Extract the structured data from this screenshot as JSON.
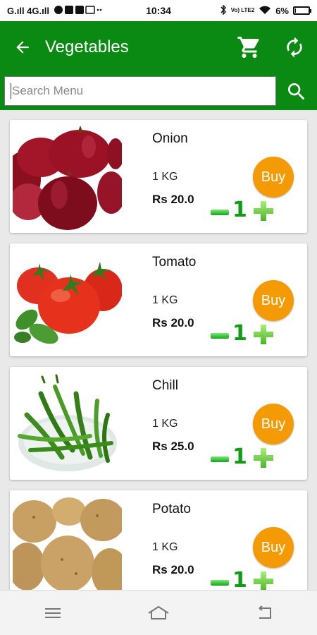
{
  "status_bar": {
    "left_text": "G.ıll 4G.ıll",
    "time": "10:34",
    "battery": "6%",
    "battery_level": 0.06,
    "network_badge": "Vo) LTE2"
  },
  "app_bar": {
    "title": "Vegetables",
    "back_icon": "arrow-left-icon",
    "cart_icon": "cart-icon",
    "refresh_icon": "refresh-icon",
    "color": "#0a8a12"
  },
  "search": {
    "placeholder": "Search Menu",
    "icon": "search-icon"
  },
  "products": [
    {
      "name": "Onion",
      "quantity": "1 KG",
      "price": "Rs 20.0",
      "buy_label": "Buy",
      "count": "1",
      "image": "onion"
    },
    {
      "name": "Tomato",
      "quantity": "1 KG",
      "price": "Rs 20.0",
      "buy_label": "Buy",
      "count": "1",
      "image": "tomato"
    },
    {
      "name": "Chill",
      "quantity": "1 KG",
      "price": "Rs 25.0",
      "buy_label": "Buy",
      "count": "1",
      "image": "chilli"
    },
    {
      "name": "Potato",
      "quantity": "1 KG",
      "price": "Rs 20.0",
      "buy_label": "Buy",
      "count": "1",
      "image": "potato"
    }
  ],
  "nav": {
    "menu_icon": "menu-icon",
    "home_icon": "home-icon",
    "back_icon": "back-icon"
  },
  "colors": {
    "buy_button": "#f39a05",
    "counter": "#119c16"
  }
}
